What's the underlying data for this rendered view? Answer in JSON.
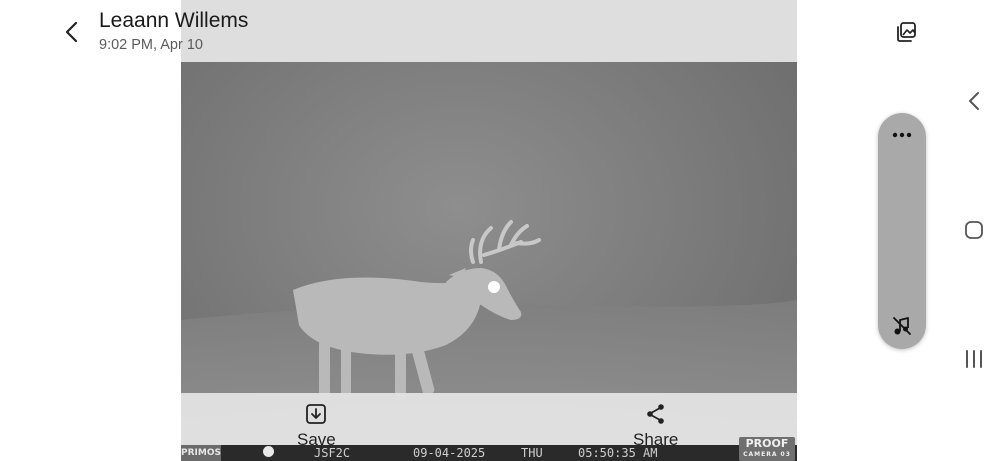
{
  "header": {
    "title": "Leaann Willems",
    "subtitle": "9:02 PM, Apr 10"
  },
  "actions": {
    "save_label": "Save",
    "share_label": "Share"
  },
  "photo_stamp": {
    "brand_left": "PRIMOS",
    "camera_id": "JSF2C",
    "date": "09-04-2025",
    "day": "THU",
    "time": "05:50:35 AM",
    "brand_right": "PROOF",
    "brand_right_sub": "CAMERA 03"
  },
  "icons": {
    "back": "chevron-left-icon",
    "gallery": "gallery-icon",
    "save": "download-icon",
    "share": "share-icon",
    "more": "more-horizontal-icon",
    "mute": "music-off-icon",
    "nav_back": "nav-back-icon",
    "nav_home": "nav-home-icon",
    "nav_recent": "nav-recent-icon"
  },
  "colors": {
    "background": "#ffffff",
    "side_panel": "#a9a9a9",
    "action_bar": "#e2e2e2"
  }
}
